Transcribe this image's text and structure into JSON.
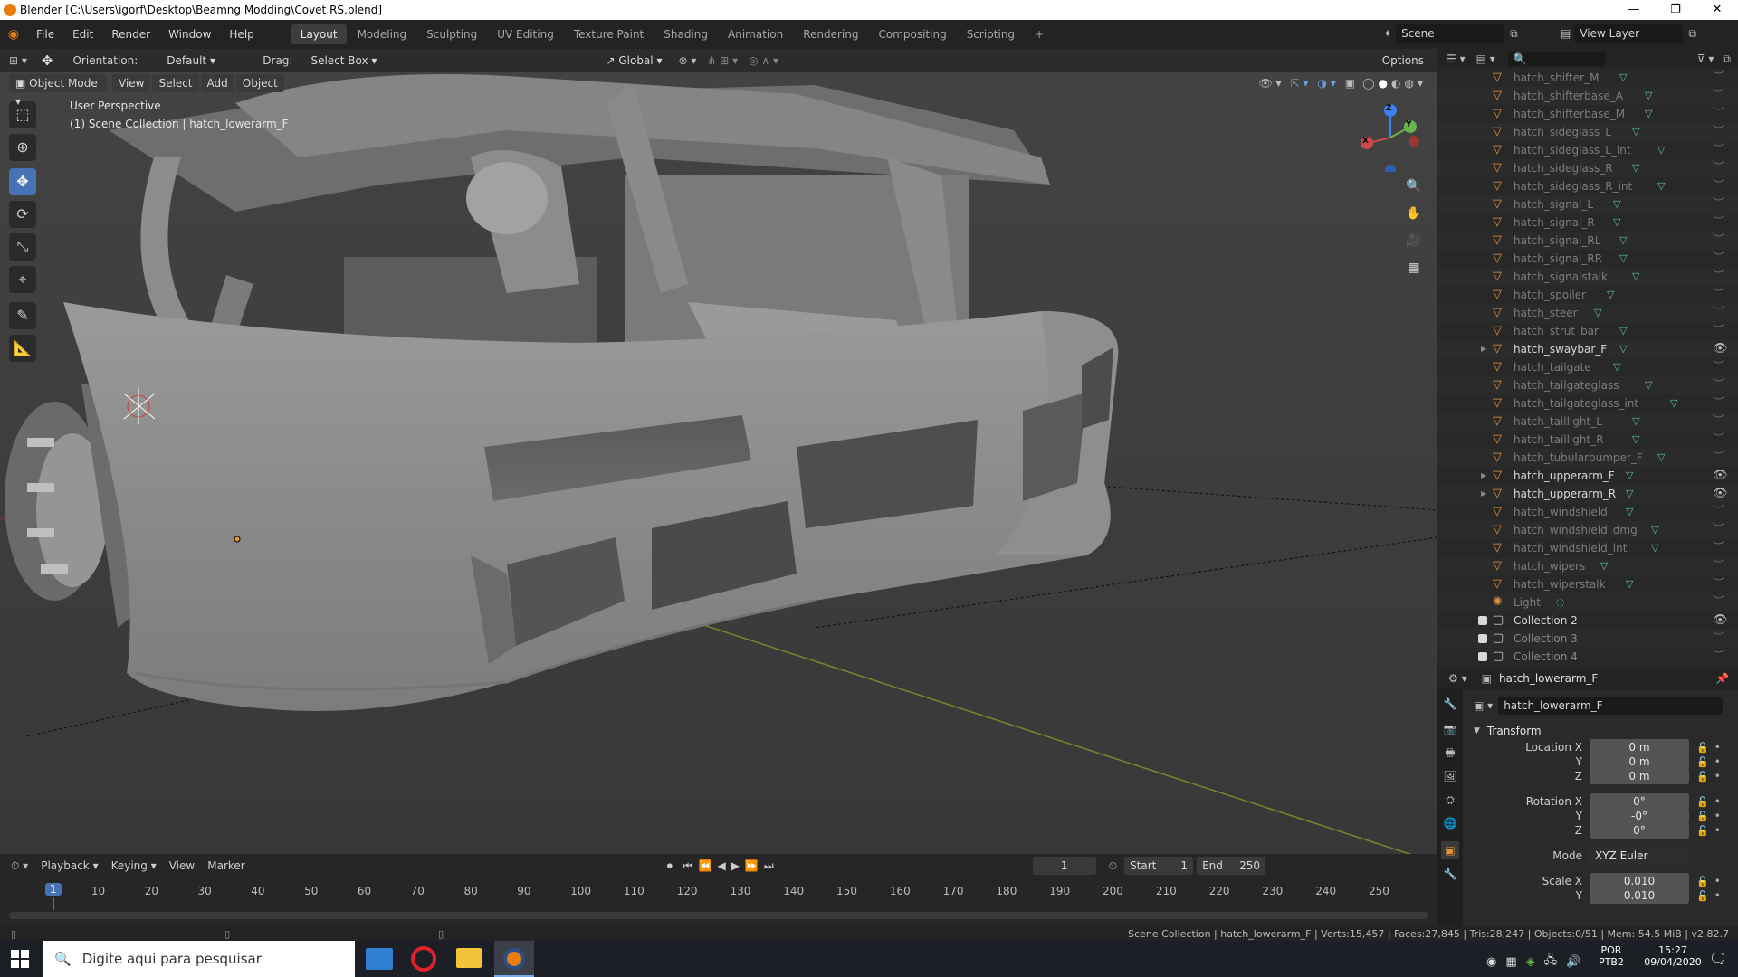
{
  "window": {
    "title": "Blender [C:\\Users\\igorf\\Desktop\\Beamng Modding\\Covet RS.blend]",
    "min": "—",
    "max": "❐",
    "close": "✕"
  },
  "menu": {
    "items": [
      "File",
      "Edit",
      "Render",
      "Window",
      "Help"
    ]
  },
  "workspaces": {
    "tabs": [
      "Layout",
      "Modeling",
      "Sculpting",
      "UV Editing",
      "Texture Paint",
      "Shading",
      "Animation",
      "Rendering",
      "Compositing",
      "Scripting"
    ],
    "add": "+"
  },
  "scene": {
    "label": "Scene",
    "view_layer": "View Layer"
  },
  "viewport_header": {
    "orientation_label": "Orientation:",
    "orientation_value": "Default",
    "drag_label": "Drag:",
    "drag_value": "Select Box",
    "transform": "Global",
    "options": "Options"
  },
  "mode_bar": {
    "mode": "Object Mode",
    "view": "View",
    "select": "Select",
    "add": "Add",
    "object": "Object"
  },
  "viewport": {
    "perspective": "User Perspective",
    "collection_info": "(1) Scene Collection | hatch_lowerarm_F"
  },
  "gizmo": {
    "z": "Z",
    "y": "Y",
    "x": "X"
  },
  "outliner": {
    "search_placeholder": "",
    "rows": [
      {
        "name": "hatch_shifter_M",
        "visible": false
      },
      {
        "name": "hatch_shifterbase_A",
        "visible": false
      },
      {
        "name": "hatch_shifterbase_M",
        "visible": false
      },
      {
        "name": "hatch_sideglass_L",
        "visible": false
      },
      {
        "name": "hatch_sideglass_L_int",
        "visible": false
      },
      {
        "name": "hatch_sideglass_R",
        "visible": false
      },
      {
        "name": "hatch_sideglass_R_int",
        "visible": false
      },
      {
        "name": "hatch_signal_L",
        "visible": false
      },
      {
        "name": "hatch_signal_R",
        "visible": false
      },
      {
        "name": "hatch_signal_RL",
        "visible": false
      },
      {
        "name": "hatch_signal_RR",
        "visible": false
      },
      {
        "name": "hatch_signalstalk",
        "visible": false
      },
      {
        "name": "hatch_spoiler",
        "visible": false
      },
      {
        "name": "hatch_steer",
        "visible": false
      },
      {
        "name": "hatch_strut_bar",
        "visible": false
      },
      {
        "name": "hatch_swaybar_F",
        "visible": true
      },
      {
        "name": "hatch_tailgate",
        "visible": false
      },
      {
        "name": "hatch_tailgateglass",
        "visible": false
      },
      {
        "name": "hatch_tailgateglass_int",
        "visible": false
      },
      {
        "name": "hatch_taillight_L",
        "visible": false
      },
      {
        "name": "hatch_taillight_R",
        "visible": false
      },
      {
        "name": "hatch_tubularbumper_F",
        "visible": false
      },
      {
        "name": "hatch_upperarm_F",
        "visible": true
      },
      {
        "name": "hatch_upperarm_R",
        "visible": true
      },
      {
        "name": "hatch_windshield",
        "visible": false
      },
      {
        "name": "hatch_windshield_dmg",
        "visible": false
      },
      {
        "name": "hatch_windshield_int",
        "visible": false
      },
      {
        "name": "hatch_wipers",
        "visible": false
      },
      {
        "name": "hatch_wiperstalk",
        "visible": false
      },
      {
        "name": "Light",
        "visible": false
      }
    ],
    "collections": [
      {
        "name": "Collection 2",
        "visible": true
      },
      {
        "name": "Collection 3",
        "visible": false
      },
      {
        "name": "Collection 4",
        "visible": false
      }
    ]
  },
  "properties": {
    "object_name": "hatch_lowerarm_F",
    "data_name": "hatch_lowerarm_F",
    "section": "Transform",
    "fields": [
      {
        "label": "Location X",
        "value": "0 m"
      },
      {
        "label": "Y",
        "value": "0 m"
      },
      {
        "label": "Z",
        "value": "0 m"
      },
      {
        "label": "Rotation X",
        "value": "0°"
      },
      {
        "label": "Y",
        "value": "-0°"
      },
      {
        "label": "Z",
        "value": "0°"
      },
      {
        "label": "Mode",
        "value": "XYZ Euler"
      },
      {
        "label": "Scale X",
        "value": "0.010"
      },
      {
        "label": "Y",
        "value": "0.010"
      }
    ]
  },
  "timeline": {
    "playback": "Playback",
    "keying": "Keying",
    "view": "View",
    "marker": "Marker",
    "current_frame": "1",
    "start_label": "Start",
    "start": "1",
    "end_label": "End",
    "end": "250",
    "ticks": [
      "1",
      "10",
      "20",
      "30",
      "40",
      "50",
      "60",
      "70",
      "80",
      "90",
      "100",
      "110",
      "120",
      "130",
      "140",
      "150",
      "160",
      "170",
      "180",
      "190",
      "200",
      "210",
      "220",
      "230",
      "240",
      "250"
    ]
  },
  "status": {
    "text": "Scene Collection | hatch_lowerarm_F | Verts:15,457 | Faces:27,845 | Tris:28,247 | Objects:0/51 | Mem: 54.5 MiB | v2.82.7"
  },
  "taskbar": {
    "search_placeholder": "Digite aqui para pesquisar",
    "lang1": "POR",
    "lang2": "PTB2",
    "time": "15:27",
    "date": "09/04/2020"
  }
}
